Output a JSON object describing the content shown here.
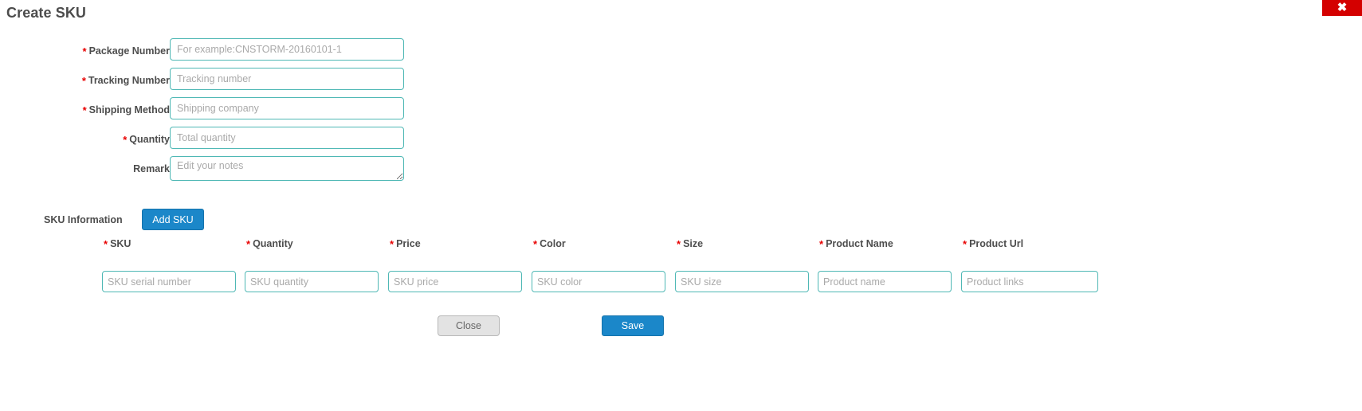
{
  "dialog": {
    "title": "Create SKU",
    "close_icon": "close-x-icon",
    "close_label": "✖"
  },
  "form": {
    "required_marker": "*",
    "fields": [
      {
        "label": "Package Number",
        "placeholder": "For example:CNSTORM-20160101-1",
        "value": "",
        "required": true,
        "type": "text"
      },
      {
        "label": "Tracking Number",
        "placeholder": "Tracking number",
        "value": "",
        "required": true,
        "type": "text"
      },
      {
        "label": "Shipping Method",
        "placeholder": "Shipping company",
        "value": "",
        "required": true,
        "type": "text"
      },
      {
        "label": "Quantity",
        "placeholder": "Total quantity",
        "value": "",
        "required": true,
        "type": "text"
      },
      {
        "label": "Remark",
        "placeholder": "Edit your notes",
        "value": "",
        "required": false,
        "type": "textarea"
      }
    ]
  },
  "sku_section": {
    "label": "SKU Information",
    "add_button_label": "Add SKU"
  },
  "sku_table": {
    "columns": [
      {
        "header": "SKU",
        "required": true,
        "placeholder": "SKU serial number",
        "value": ""
      },
      {
        "header": "Quantity",
        "required": true,
        "placeholder": "SKU quantity",
        "value": ""
      },
      {
        "header": "Price",
        "required": true,
        "placeholder": "SKU price",
        "value": ""
      },
      {
        "header": "Color",
        "required": true,
        "placeholder": "SKU color",
        "value": ""
      },
      {
        "header": "Size",
        "required": true,
        "placeholder": "SKU size",
        "value": ""
      },
      {
        "header": "Product Name",
        "required": true,
        "placeholder": "Product name",
        "value": ""
      },
      {
        "header": "Product Url",
        "required": true,
        "placeholder": "Product links",
        "value": ""
      }
    ]
  },
  "footer": {
    "close_label": "Close",
    "save_label": "Save"
  },
  "colors": {
    "field_border": "#4fb8b5",
    "primary_button": "#1b87c9",
    "close_button": "#e3e3e3",
    "required_star": "#e80000",
    "window_close": "#d40000"
  }
}
